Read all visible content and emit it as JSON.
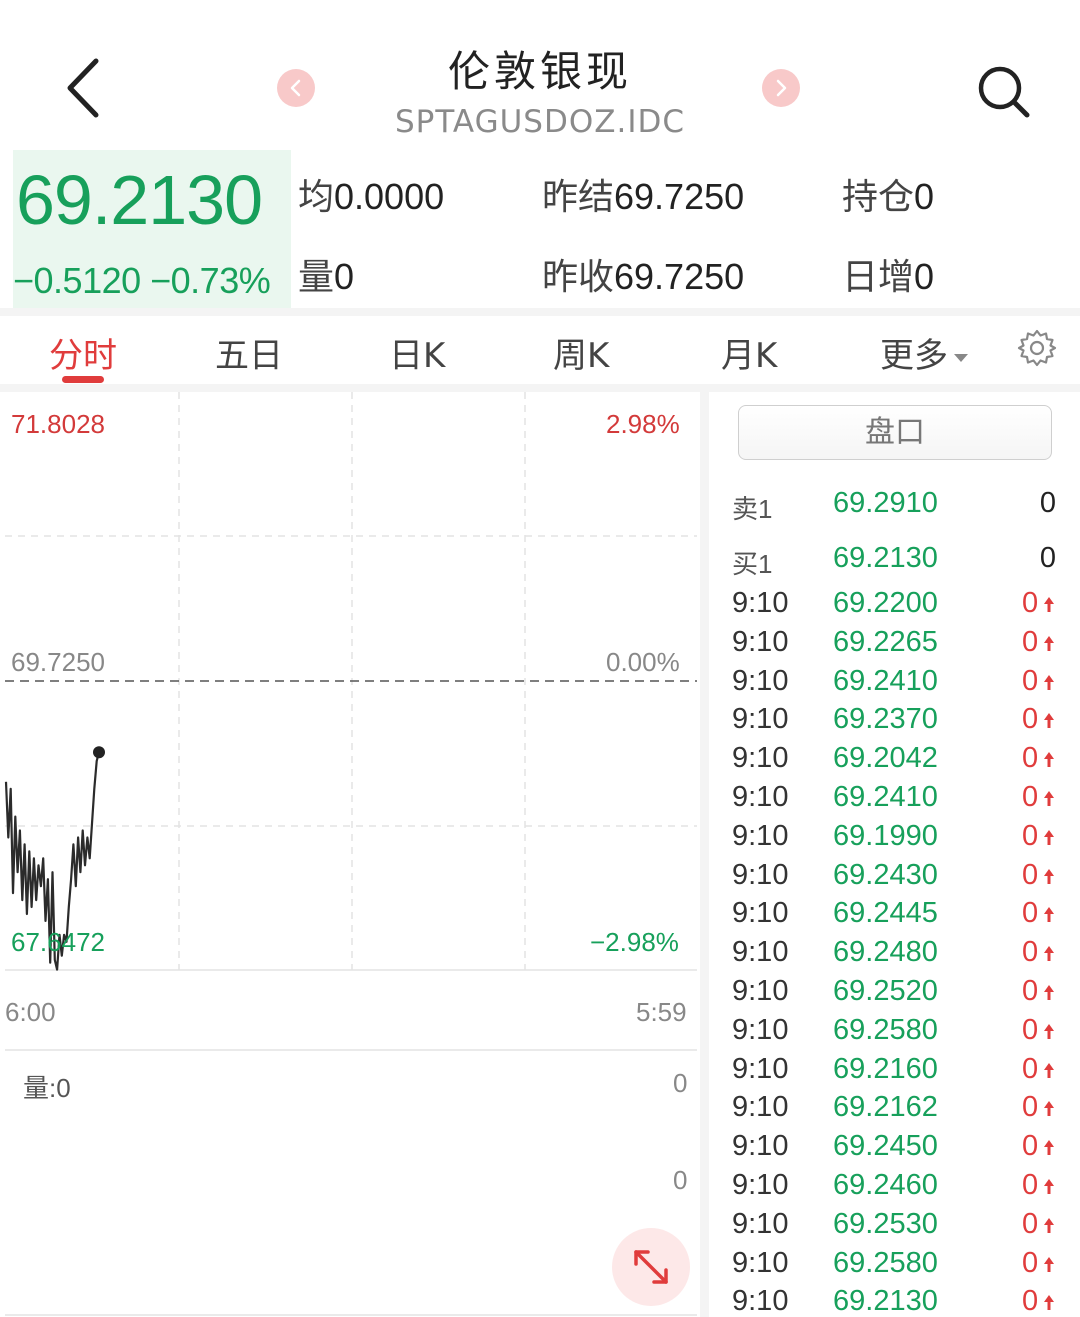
{
  "header": {
    "title": "伦敦银现",
    "subtitle": "SPTAGUSDOZ.IDC",
    "icons": {
      "back": "chevron-left-icon",
      "search": "search-icon",
      "prev": "chevron-left-icon",
      "next": "chevron-right-icon"
    }
  },
  "quote": {
    "last_price": "69.2130",
    "change": "−0.5120 −0.73%",
    "avg_label": "均",
    "avg_value": "0.0000",
    "prev_settle_label": "昨结",
    "prev_settle_value": "69.7250",
    "open_interest_label": "持仓",
    "open_interest_value": "0",
    "volume_label": "量",
    "volume_value": "0",
    "prev_close_label": "昨收",
    "prev_close_value": "69.7250",
    "daily_increase_label": "日增",
    "daily_increase_value": "0"
  },
  "tabs": [
    {
      "label": "分时",
      "active": true
    },
    {
      "label": "五日"
    },
    {
      "label": "日K"
    },
    {
      "label": "周K"
    },
    {
      "label": "月K"
    },
    {
      "label": "更多"
    }
  ],
  "chart": {
    "price_high": "71.8028",
    "price_mid": "69.7250",
    "price_low": "67.6472",
    "pct_high": "2.98%",
    "pct_mid": "0.00%",
    "pct_low": "−2.98%",
    "time_start": "6:00",
    "time_end": "5:59",
    "volume_label": "量:0",
    "vol_axis_top": "0",
    "vol_axis_mid": "0"
  },
  "chart_data": {
    "type": "line",
    "ylim": [
      67.6472,
      71.8028
    ],
    "reference": 69.725,
    "x": [
      0,
      1,
      2,
      3,
      4,
      5,
      6,
      7,
      8,
      9,
      10,
      11,
      12,
      13,
      14,
      15,
      16,
      17,
      18,
      19,
      20,
      21,
      22,
      23,
      24,
      25,
      26,
      27,
      28,
      29,
      30,
      31,
      32,
      33,
      34,
      35,
      36,
      37,
      38,
      39,
      40
    ],
    "values": [
      69.0,
      68.6,
      68.95,
      68.2,
      68.75,
      68.35,
      68.65,
      68.15,
      68.55,
      68.05,
      68.5,
      68.1,
      68.45,
      68.15,
      68.4,
      68.25,
      68.45,
      68.0,
      68.3,
      67.7,
      68.35,
      67.72,
      67.65,
      67.9,
      67.75,
      67.9,
      67.85,
      68.1,
      68.3,
      68.55,
      68.25,
      68.6,
      68.35,
      68.65,
      68.4,
      68.6,
      68.45,
      68.7,
      68.95,
      69.15,
      69.213
    ]
  },
  "orderbook": {
    "panel_label": "盘口",
    "ask": {
      "label": "卖1",
      "price": "69.2910",
      "volume": "0"
    },
    "bid": {
      "label": "买1",
      "price": "69.2130",
      "volume": "0"
    }
  },
  "ticks": [
    {
      "time": "9:10",
      "price": "69.2200",
      "volume": "0"
    },
    {
      "time": "9:10",
      "price": "69.2265",
      "volume": "0"
    },
    {
      "time": "9:10",
      "price": "69.2410",
      "volume": "0"
    },
    {
      "time": "9:10",
      "price": "69.2370",
      "volume": "0"
    },
    {
      "time": "9:10",
      "price": "69.2042",
      "volume": "0"
    },
    {
      "time": "9:10",
      "price": "69.2410",
      "volume": "0"
    },
    {
      "time": "9:10",
      "price": "69.1990",
      "volume": "0"
    },
    {
      "time": "9:10",
      "price": "69.2430",
      "volume": "0"
    },
    {
      "time": "9:10",
      "price": "69.2445",
      "volume": "0"
    },
    {
      "time": "9:10",
      "price": "69.2480",
      "volume": "0"
    },
    {
      "time": "9:10",
      "price": "69.2520",
      "volume": "0"
    },
    {
      "time": "9:10",
      "price": "69.2580",
      "volume": "0"
    },
    {
      "time": "9:10",
      "price": "69.2160",
      "volume": "0"
    },
    {
      "time": "9:10",
      "price": "69.2162",
      "volume": "0"
    },
    {
      "time": "9:10",
      "price": "69.2450",
      "volume": "0"
    },
    {
      "time": "9:10",
      "price": "69.2460",
      "volume": "0"
    },
    {
      "time": "9:10",
      "price": "69.2530",
      "volume": "0"
    },
    {
      "time": "9:10",
      "price": "69.2580",
      "volume": "0"
    },
    {
      "time": "9:10",
      "price": "69.2130",
      "volume": "0"
    }
  ],
  "colors": {
    "up": "#e03c3c",
    "down": "#17a05b",
    "accent": "#e03c3c"
  }
}
